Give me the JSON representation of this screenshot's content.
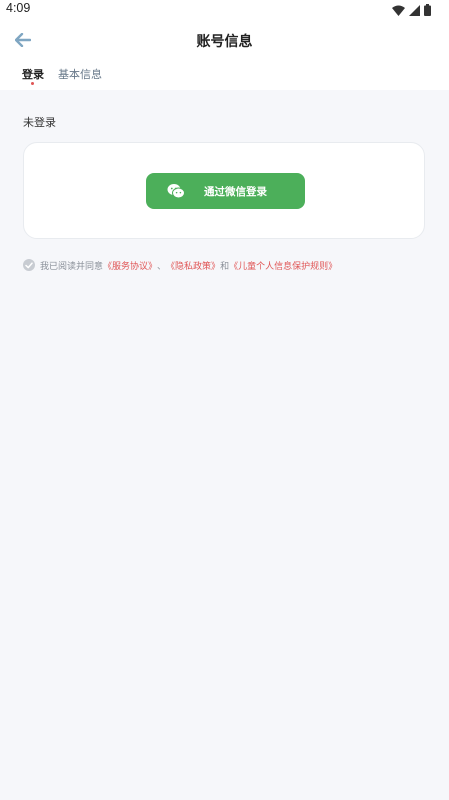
{
  "status_bar": {
    "time": "4:09"
  },
  "header": {
    "title": "账号信息"
  },
  "tabs": [
    {
      "label": "登录",
      "active": true
    },
    {
      "label": "基本信息",
      "active": false
    }
  ],
  "login": {
    "status": "未登录",
    "wechat_button_label": "通过微信登录",
    "agreement": {
      "prefix": "我已阅读并同意",
      "service_link": "《服务协议》",
      "sep1": "、",
      "privacy_link": "《隐私政策》",
      "sep2": "和",
      "children_link": "《儿童个人信息保护规则》"
    }
  },
  "colors": {
    "accent": "#4caf5a",
    "link": "#e05555",
    "background": "#f6f7fa"
  },
  "icons": [
    "back-arrow-icon",
    "wechat-icon",
    "check-circle-icon",
    "wifi-icon",
    "signal-icon",
    "battery-icon"
  ]
}
